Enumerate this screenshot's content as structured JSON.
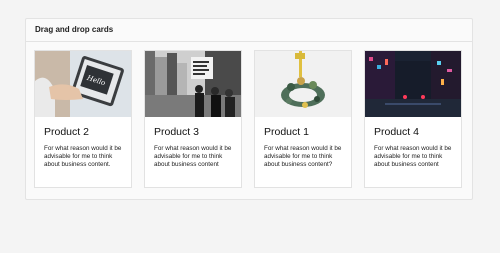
{
  "panel": {
    "title": "Drag and drop cards"
  },
  "cards": [
    {
      "title": "Product 2",
      "text": "For what reason would it be advisable for me to think about business content.",
      "image": "hand-holding-tablet-photo"
    },
    {
      "title": "Product 3",
      "text": "For what reason would it be advisable for me to think about business content",
      "image": "street-protest-photo"
    },
    {
      "title": "Product 1",
      "text": "For what reason would it be advisable for me to think about business content?",
      "image": "figures-on-ring-photo"
    },
    {
      "title": "Product 4",
      "text": "For what reason would it be advisable for me to think about business content",
      "image": "neon-city-night-photo"
    }
  ]
}
